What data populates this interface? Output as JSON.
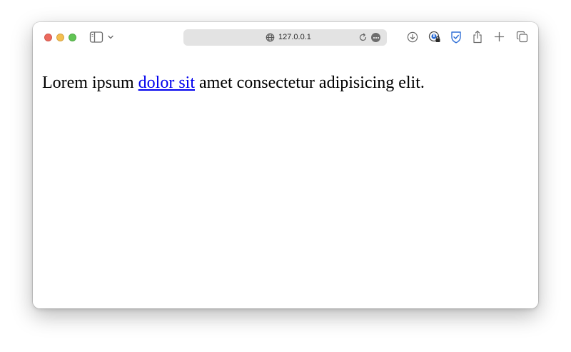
{
  "browser": {
    "address_bar": {
      "url": "127.0.0.1"
    },
    "traffic_lights": [
      "close",
      "minimize",
      "maximize"
    ],
    "toolbar_icons": [
      "sidebar-icon",
      "chevron-down-icon",
      "globe-icon",
      "reload-icon",
      "more-icon",
      "download-icon",
      "password-icon",
      "bitwarden-icon",
      "share-icon",
      "new-tab-icon",
      "tabs-overview-icon"
    ]
  },
  "page": {
    "text_before": "Lorem ipsum ",
    "link_text": "dolor sit",
    "text_after": " amet consectetur adipisicing elit.",
    "link_color": "#0000ee"
  }
}
